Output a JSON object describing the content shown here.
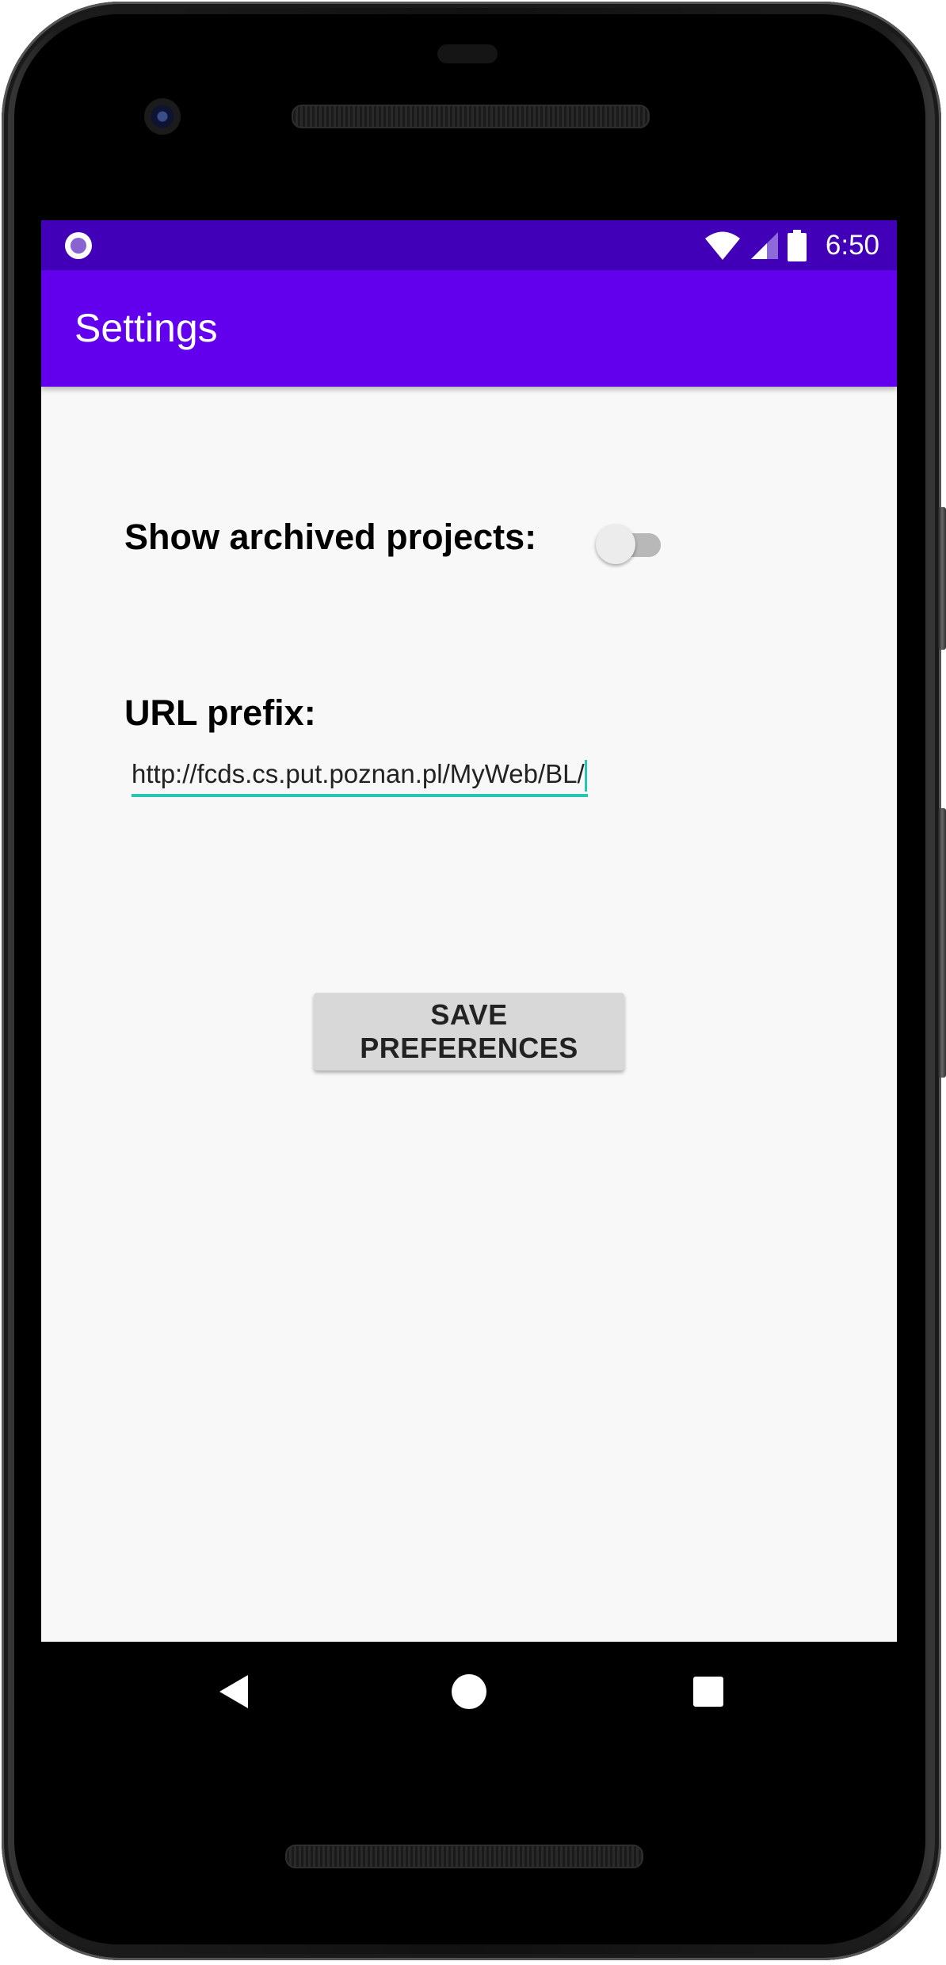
{
  "status_bar": {
    "time": "6:50"
  },
  "app_bar": {
    "title": "Settings"
  },
  "settings": {
    "archived_label": "Show archived projects:",
    "archived_enabled": false,
    "url_label": "URL prefix:",
    "url_value": "http://fcds.cs.put.poznan.pl/MyWeb/BL/"
  },
  "actions": {
    "save_label": "SAVE PREFERENCES"
  },
  "colors": {
    "status_bar": "#4100b8",
    "app_bar": "#6200ee",
    "accent": "#26c6b5",
    "background": "#f8f8f8"
  },
  "icons": {
    "status_left": "notification-circle-icon",
    "wifi": "wifi-icon",
    "signal": "cell-signal-icon",
    "battery": "battery-icon",
    "nav_back": "back-triangle-icon",
    "nav_home": "home-circle-icon",
    "nav_recents": "recents-square-icon"
  }
}
